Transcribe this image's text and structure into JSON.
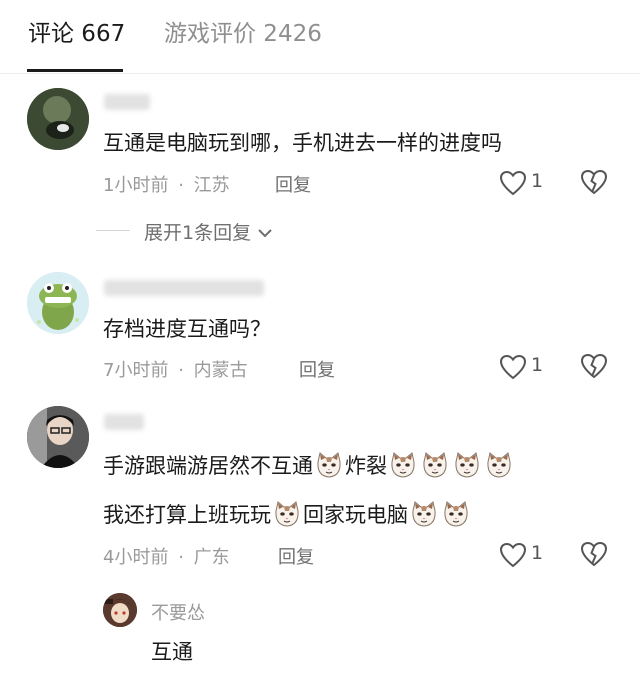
{
  "tabs": {
    "comments": "评论 667",
    "reviews": "游戏评价 2426"
  },
  "comments": [
    {
      "text": "互通是电脑玩到哪，手机进去一样的进度吗",
      "time": "1小时前",
      "location": "江苏",
      "reply_label": "回复",
      "likes": "1",
      "expand_label": "展开1条回复"
    },
    {
      "text": "存档进度互通吗？",
      "time": "7小时前",
      "location": "内蒙古",
      "reply_label": "回复",
      "likes": "1"
    },
    {
      "text_line1_a": "手游跟端游居然不互通",
      "text_line1_b": "炸裂",
      "text_line2_a": "我还打算上班玩玩",
      "text_line2_b": "回家玩电脑",
      "time": "4小时前",
      "location": "广东",
      "reply_label": "回复",
      "likes": "1",
      "sub_reply": {
        "author": "不要怂",
        "text": "互通"
      }
    }
  ],
  "meta_separator": "·",
  "icons": {
    "like": "heart-outline-icon",
    "dislike": "broken-heart-icon",
    "expand": "chevron-down-icon",
    "emoji": "cat-face-emoji"
  }
}
